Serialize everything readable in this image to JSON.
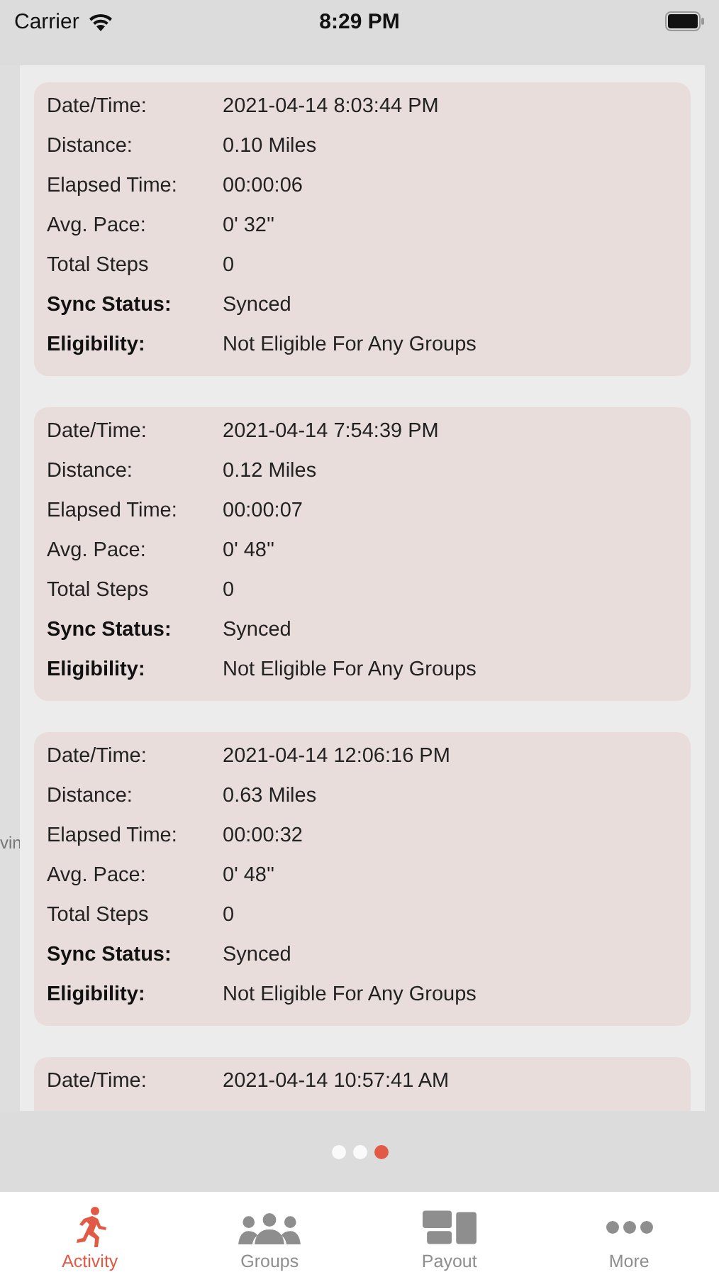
{
  "status_bar": {
    "carrier": "Carrier",
    "time": "8:29 PM"
  },
  "background_page": {
    "fragment": "vin"
  },
  "records": [
    {
      "fields": [
        {
          "label": "Date/Time:",
          "value": "2021-04-14 8:03:44 PM",
          "strong": false
        },
        {
          "label": "Distance:",
          "value": "0.10 Miles",
          "strong": false
        },
        {
          "label": "Elapsed Time:",
          "value": "00:00:06",
          "strong": false
        },
        {
          "label": "Avg. Pace:",
          "value": "0' 32''",
          "strong": false
        },
        {
          "label": "Total Steps",
          "value": "0",
          "strong": false
        },
        {
          "label": "Sync Status:",
          "value": "Synced",
          "strong": true
        },
        {
          "label": "Eligibility:",
          "value": "Not Eligible For Any Groups",
          "strong": true
        }
      ]
    },
    {
      "fields": [
        {
          "label": "Date/Time:",
          "value": "2021-04-14 7:54:39 PM",
          "strong": false
        },
        {
          "label": "Distance:",
          "value": "0.12 Miles",
          "strong": false
        },
        {
          "label": "Elapsed Time:",
          "value": "00:00:07",
          "strong": false
        },
        {
          "label": "Avg. Pace:",
          "value": "0' 48''",
          "strong": false
        },
        {
          "label": "Total Steps",
          "value": "0",
          "strong": false
        },
        {
          "label": "Sync Status:",
          "value": "Synced",
          "strong": true
        },
        {
          "label": "Eligibility:",
          "value": "Not Eligible For Any Groups",
          "strong": true
        }
      ]
    },
    {
      "fields": [
        {
          "label": "Date/Time:",
          "value": "2021-04-14 12:06:16 PM",
          "strong": false
        },
        {
          "label": "Distance:",
          "value": "0.63 Miles",
          "strong": false
        },
        {
          "label": "Elapsed Time:",
          "value": "00:00:32",
          "strong": false
        },
        {
          "label": "Avg. Pace:",
          "value": "0' 48''",
          "strong": false
        },
        {
          "label": "Total Steps",
          "value": "0",
          "strong": false
        },
        {
          "label": "Sync Status:",
          "value": "Synced",
          "strong": true
        },
        {
          "label": "Eligibility:",
          "value": "Not Eligible For Any Groups",
          "strong": true
        }
      ]
    },
    {
      "fields": [
        {
          "label": "Date/Time:",
          "value": "2021-04-14 10:57:41 AM",
          "strong": false
        }
      ]
    }
  ],
  "page_dots": [
    {
      "selected": false
    },
    {
      "selected": false
    },
    {
      "selected": true
    }
  ],
  "tabs": [
    {
      "label": "Activity",
      "kind": "runner",
      "selected": true
    },
    {
      "label": "Groups",
      "kind": "people",
      "selected": false
    },
    {
      "label": "Payout",
      "kind": "tiles",
      "selected": false
    },
    {
      "label": "More",
      "kind": "dots",
      "selected": false
    }
  ]
}
